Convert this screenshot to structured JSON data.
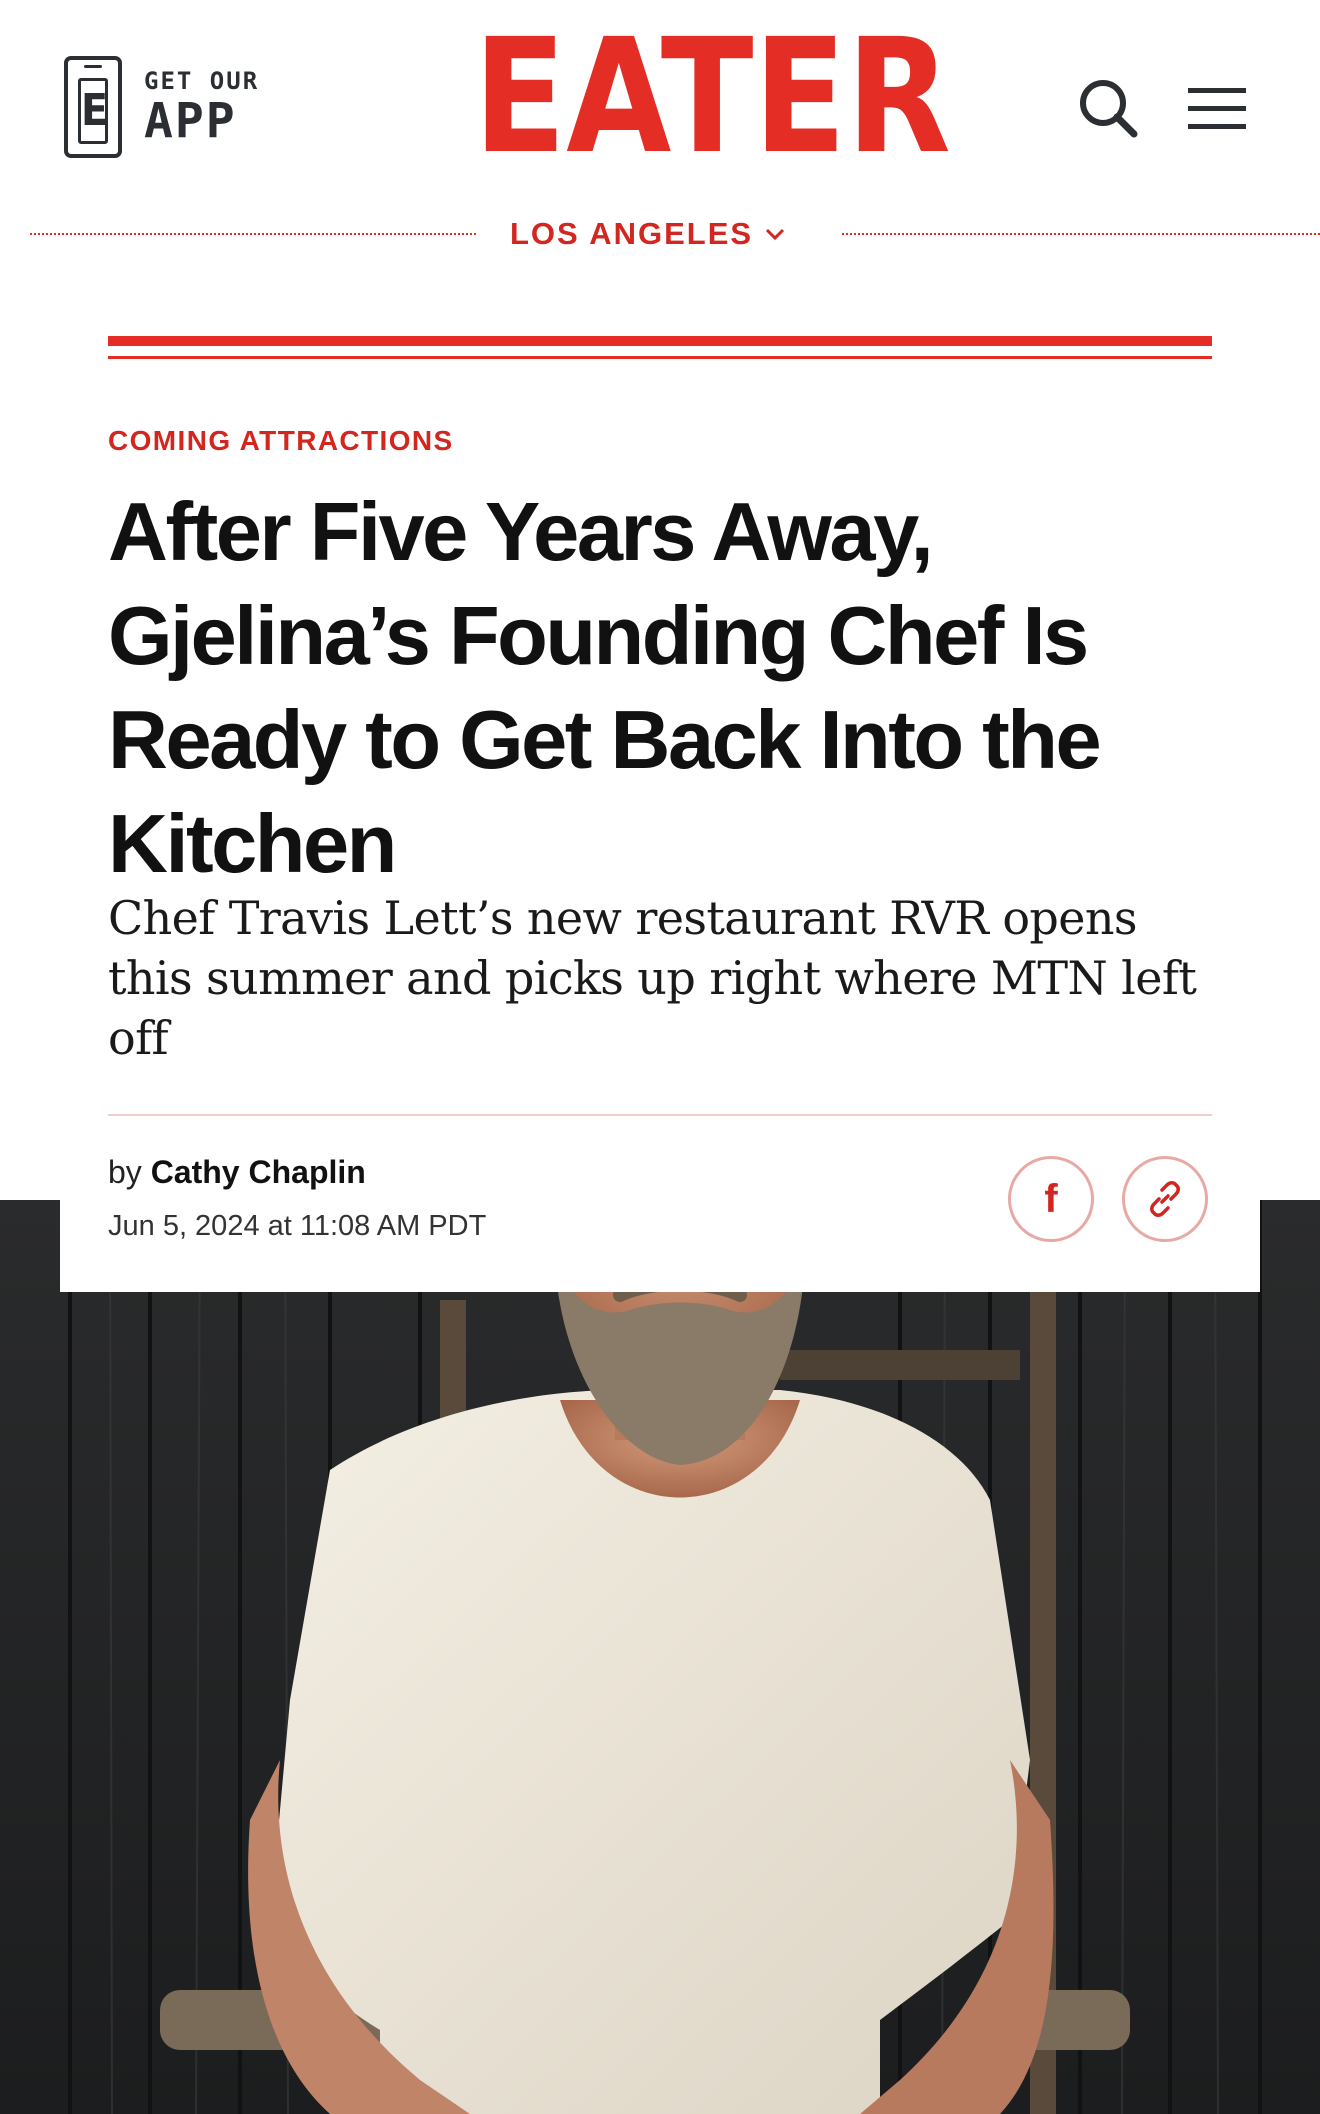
{
  "header": {
    "app_promo": {
      "line1": "GET OUR",
      "line2": "APP",
      "phone_letter": "E"
    },
    "logo": "EATER",
    "city": "LOS ANGELES",
    "icons": {
      "search": "search-icon",
      "menu": "hamburger-menu-icon",
      "city_dropdown": "chevron-down-icon"
    },
    "accent_color": "#e42d24"
  },
  "article": {
    "kicker": "COMING ATTRACTIONS",
    "headline": "After Five Years Away, Gjelina’s Founding Chef Is Ready to Get Back Into the Kitchen",
    "dek": "Chef Travis Lett’s new restaurant RVR opens this summer and picks up right where MTN left off",
    "byline_prefix": "by",
    "author": "Cathy Chaplin",
    "timestamp": "Jun 5, 2024 at 11:08 AM PDT",
    "share": {
      "facebook_glyph": "f",
      "facebook_icon": "facebook-icon",
      "link_icon": "link-icon"
    }
  }
}
